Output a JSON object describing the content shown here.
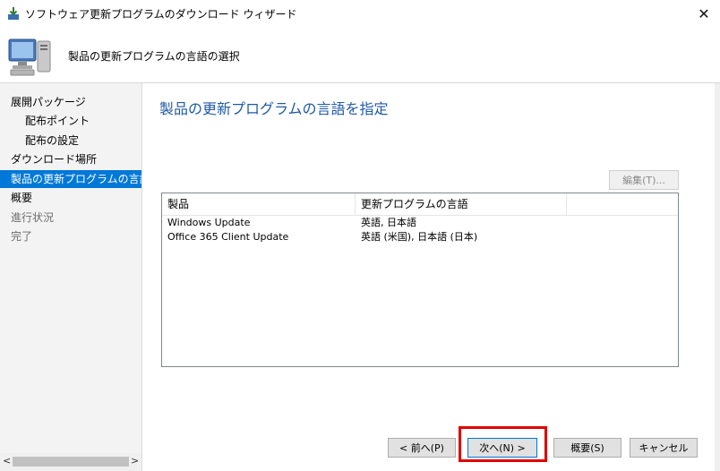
{
  "window": {
    "title": "ソフトウェア更新プログラムのダウンロード ウィザード",
    "close_symbol": "✕"
  },
  "header": {
    "title": "製品の更新プログラムの言語の選択"
  },
  "sidebar": {
    "items": [
      {
        "label": "展開パッケージ",
        "level": "top",
        "state": "normal"
      },
      {
        "label": "配布ポイント",
        "level": "sub",
        "state": "normal"
      },
      {
        "label": "配布の設定",
        "level": "sub",
        "state": "normal"
      },
      {
        "label": "ダウンロード場所",
        "level": "top",
        "state": "normal"
      },
      {
        "label": "製品の更新プログラムの言語の",
        "level": "top",
        "state": "active"
      },
      {
        "label": "概要",
        "level": "top",
        "state": "normal"
      },
      {
        "label": "進行状況",
        "level": "top",
        "state": "disabled"
      },
      {
        "label": "完了",
        "level": "top",
        "state": "disabled"
      }
    ],
    "scroll_left": "<",
    "scroll_right": ">"
  },
  "main": {
    "page_title": "製品の更新プログラムの言語を指定",
    "edit_button": "編集(T)...",
    "table": {
      "columns": [
        "製品",
        "更新プログラムの言語"
      ],
      "rows": [
        [
          "Windows Update",
          "英語, 日本語"
        ],
        [
          "Office 365 Client Update",
          "英語 (米国), 日本語 (日本)"
        ]
      ]
    }
  },
  "buttons": {
    "back": "< 前へ(P)",
    "next": "次へ(N) >",
    "summary": "概要(S)",
    "cancel": "キャンセル"
  },
  "colors": {
    "accent": "#0078d7",
    "title_blue": "#1f5aa6",
    "highlight_red": "#e00000"
  }
}
